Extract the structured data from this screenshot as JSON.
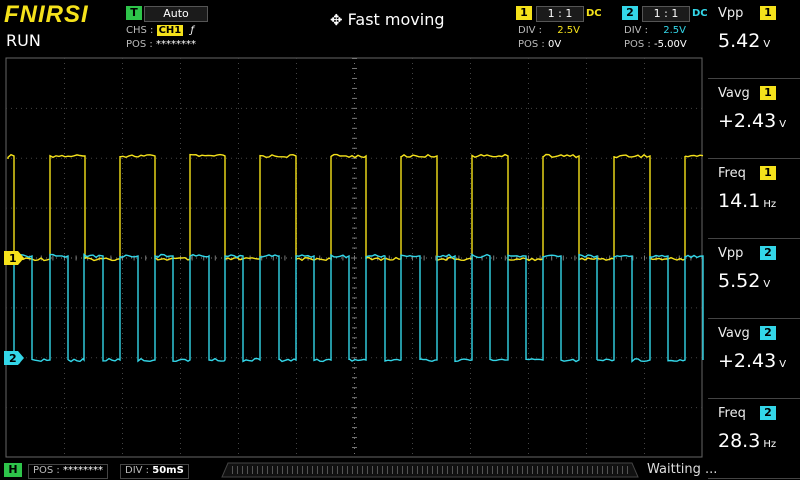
{
  "brand": "FNIRSI",
  "run_state": "RUN",
  "trigger": {
    "badge": "T",
    "mode": "Auto",
    "chs_label": "CHS :",
    "chs_channel": "CH1",
    "edge_icon": "rising-edge-icon",
    "pos_label": "POS :",
    "pos_value": "********"
  },
  "header_title": "Fast moving",
  "ch1": {
    "num": "1",
    "ratio": "1 : 1",
    "coupling": "DC",
    "div_label": "DIV :",
    "div": "2.5V",
    "pos_label": "POS :",
    "pos": "0V",
    "color": "#f5e21b"
  },
  "ch2": {
    "num": "2",
    "ratio": "1 : 1",
    "coupling": "DC",
    "div_label": "DIV :",
    "div": "2.5V",
    "pos_label": "POS :",
    "pos": "-5.00V",
    "color": "#33d6e8"
  },
  "measurements": [
    {
      "label": "Vpp",
      "channel": "1",
      "value": "5.42",
      "unit": "V"
    },
    {
      "label": "Vavg",
      "channel": "1",
      "value": "+2.43",
      "unit": "V"
    },
    {
      "label": "Freq",
      "channel": "1",
      "value": "14.1",
      "unit": "Hz"
    },
    {
      "label": "Vpp",
      "channel": "2",
      "value": "5.52",
      "unit": "V"
    },
    {
      "label": "Vavg",
      "channel": "2",
      "value": "+2.43",
      "unit": "V"
    },
    {
      "label": "Freq",
      "channel": "2",
      "value": "28.3",
      "unit": "Hz"
    }
  ],
  "bottom": {
    "h_badge": "H",
    "pos_label": "POS :",
    "pos_value": "********",
    "div_label": "DIV :",
    "div_value": "50mS",
    "status": "Waitting ..."
  },
  "markers": {
    "ch1": "1",
    "ch2": "2"
  }
}
